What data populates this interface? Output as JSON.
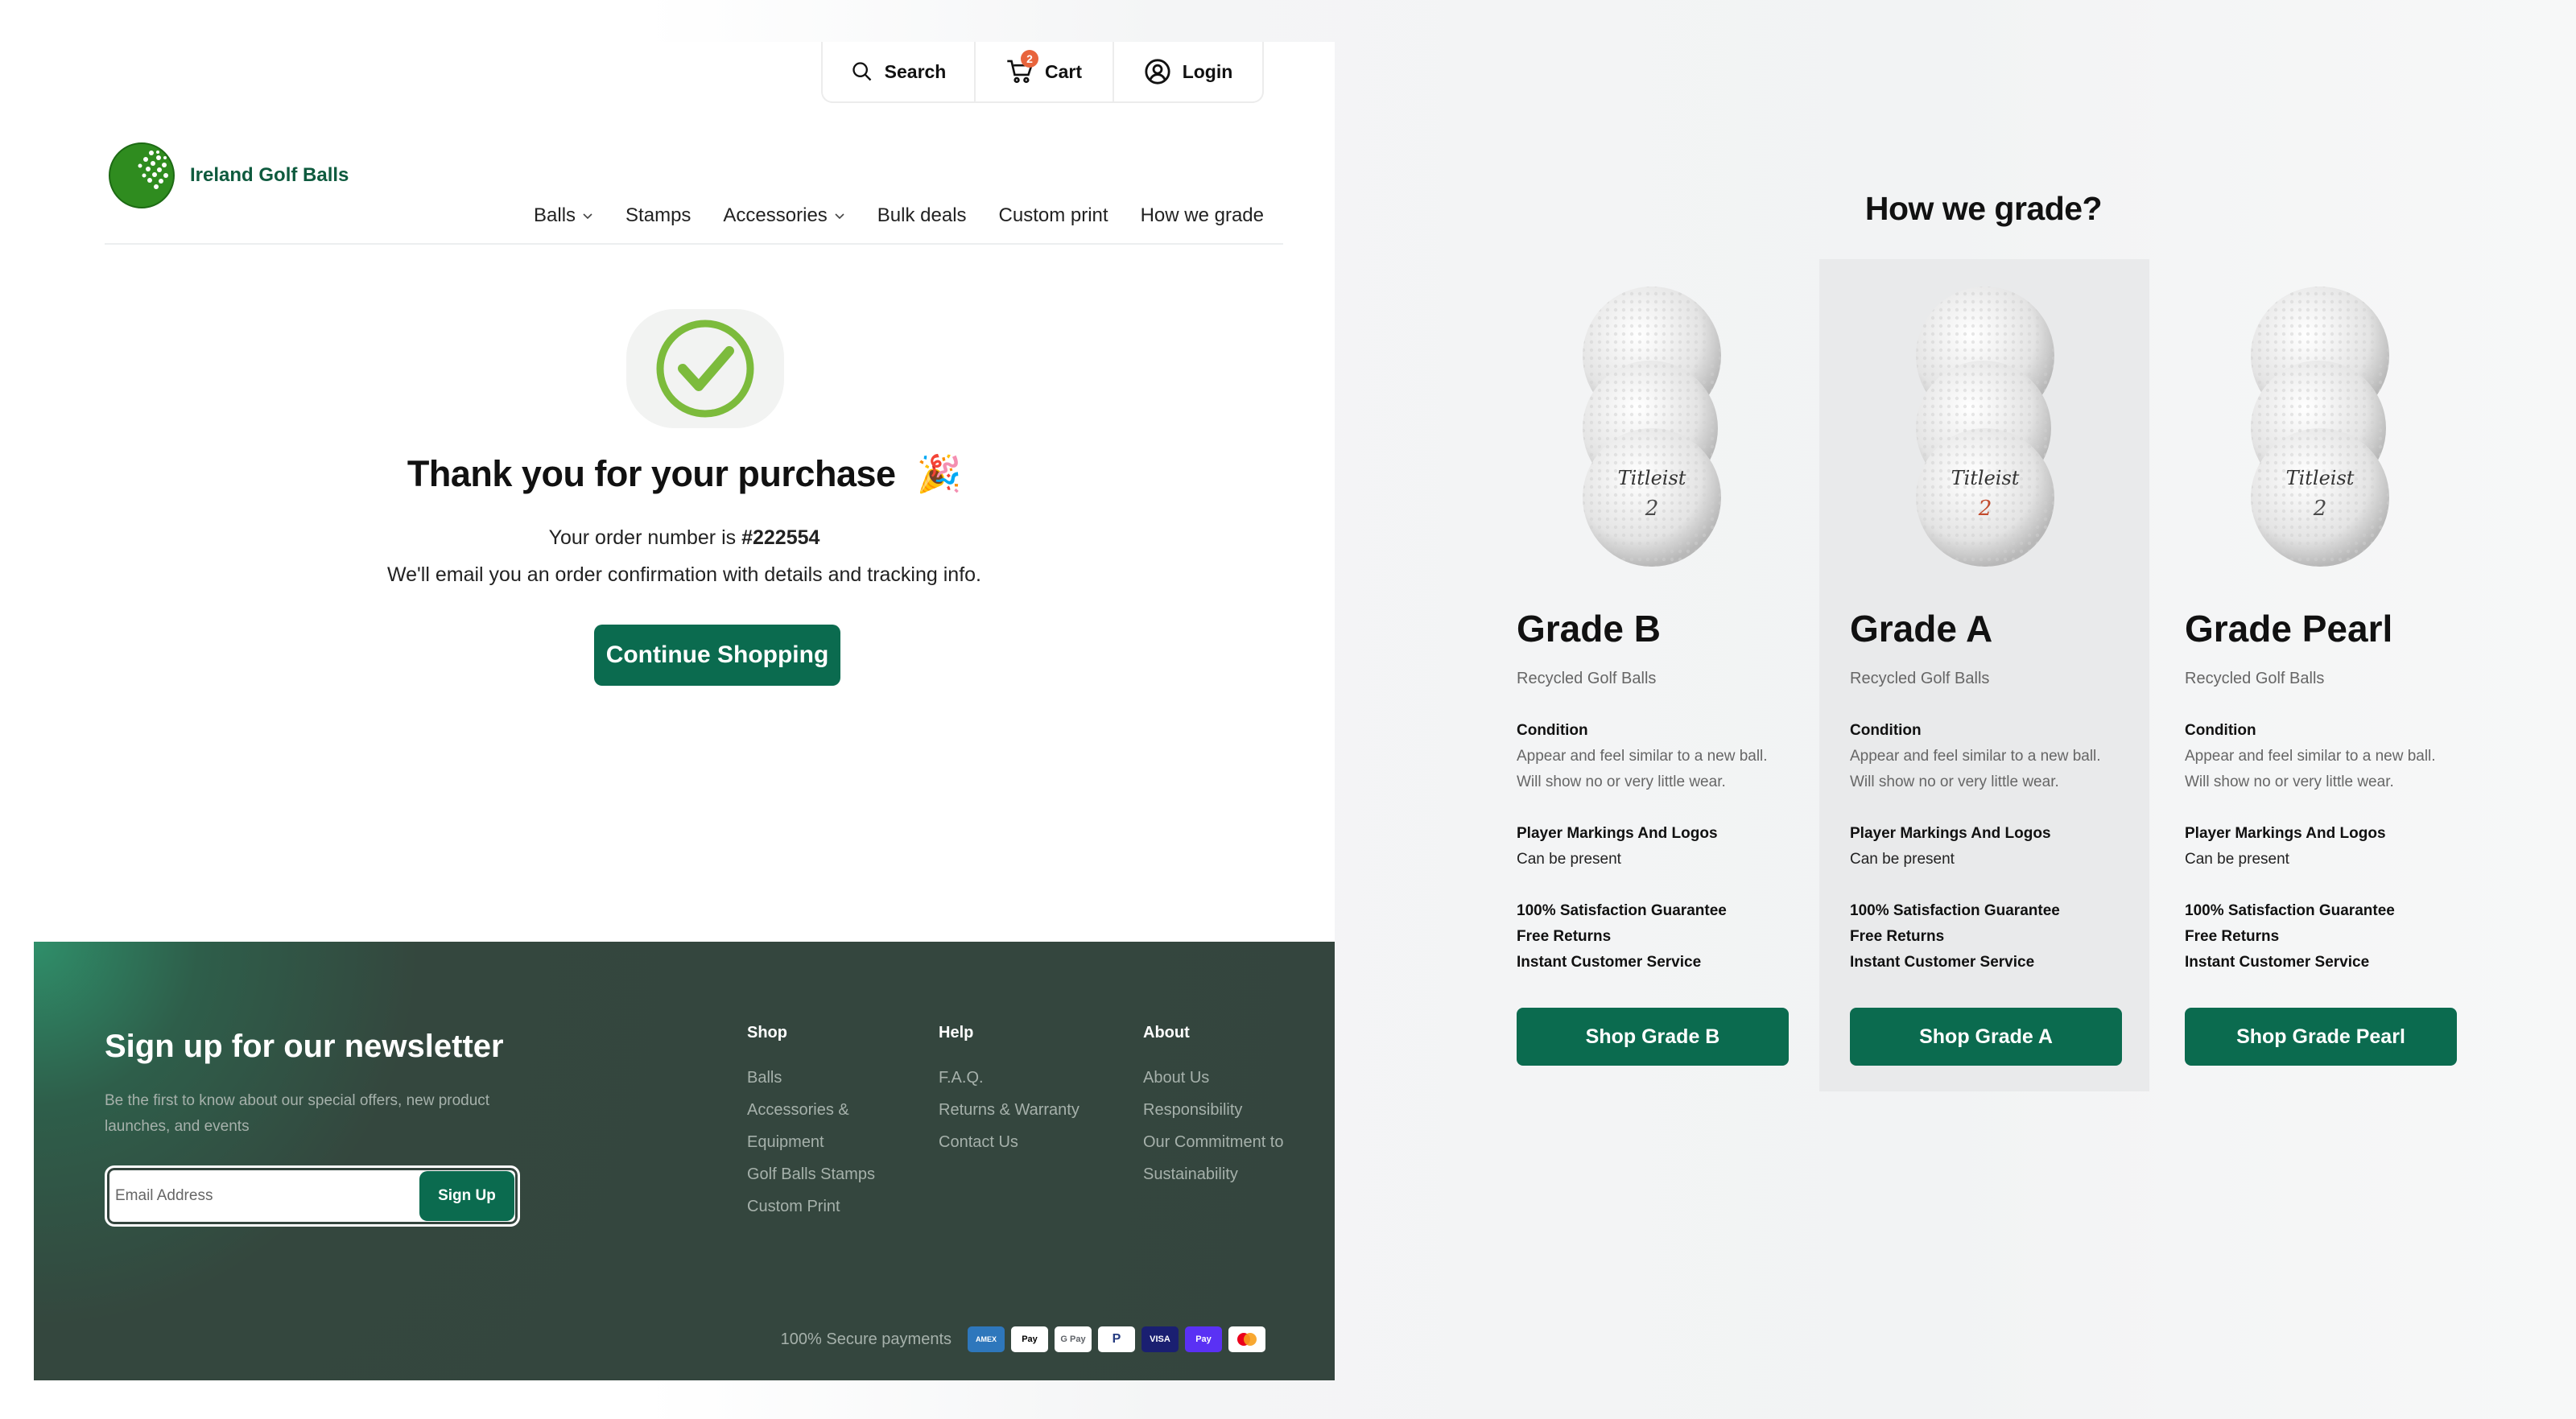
{
  "util_bar": {
    "search": "Search",
    "cart": "Cart",
    "cart_count": "2",
    "login": "Login"
  },
  "brand": {
    "name": "Ireland Golf Balls"
  },
  "nav": [
    "Balls",
    "Stamps",
    "Accessories",
    "Bulk deals",
    "Custom print",
    "How we grade"
  ],
  "confirmation": {
    "title": "Thank you for your purchase",
    "emoji": "🎉",
    "order_prefix": "Your order number is ",
    "order_number": "#222554",
    "email_note": "We'll email you an order confirmation with details and tracking info.",
    "cta": "Continue Shopping"
  },
  "footer": {
    "newsletter_title": "Sign up for our newsletter",
    "newsletter_desc": "Be the first to know about our special offers, new product launches, and events",
    "email_placeholder": "Email Address",
    "signup": "Sign Up",
    "columns": [
      {
        "title": "Shop",
        "links": [
          "Balls",
          "Accessories &",
          "Equipment",
          "Golf Balls Stamps",
          "Custom Print"
        ]
      },
      {
        "title": "Help",
        "links": [
          "F.A.Q.",
          "Returns & Warranty",
          "Contact Us"
        ]
      },
      {
        "title": "About",
        "links": [
          "About Us",
          "Responsibility",
          "Our Commitment to",
          "Sustainability"
        ]
      }
    ],
    "secure": "100% Secure payments",
    "payment_icons": [
      "amex-icon",
      "apple-pay-icon",
      "google-pay-icon",
      "paypal-icon",
      "visa-icon",
      "shop-pay-icon",
      "mastercard-icon"
    ]
  },
  "grading": {
    "title": "How we grade?",
    "grades": [
      {
        "name": "Grade B",
        "subtitle": "Recycled Golf Balls",
        "condition_label": "Condition",
        "condition_line1": "Appear and feel similar to a new ball.",
        "condition_line2": "Will show no or very little wear.",
        "markings_label": "Player Markings And Logos",
        "markings_value": "Can be present",
        "guarantee": "100% Satisfaction Guarantee",
        "returns": "Free Returns",
        "service": "Instant Customer Service",
        "cta": "Shop Grade B"
      },
      {
        "name": "Grade A",
        "subtitle": "Recycled Golf Balls",
        "condition_label": "Condition",
        "condition_line1": "Appear and feel similar to a new ball.",
        "condition_line2": "Will show no or very little wear.",
        "markings_label": "Player Markings And Logos",
        "markings_value": "Can be present",
        "guarantee": "100% Satisfaction Guarantee",
        "returns": "Free Returns",
        "service": "Instant Customer Service",
        "cta": "Shop Grade A"
      },
      {
        "name": "Grade Pearl",
        "subtitle": "Recycled Golf Balls",
        "condition_label": "Condition",
        "condition_line1": "Appear and feel similar to a new ball.",
        "condition_line2": "Will show no or very little wear.",
        "markings_label": "Player Markings And Logos",
        "markings_value": "Can be present",
        "guarantee": "100% Satisfaction Guarantee",
        "returns": "Free Returns",
        "service": "Instant Customer Service",
        "cta": "Shop Grade Pearl"
      }
    ],
    "ball_brand": "Titleist",
    "ball_number": "2"
  },
  "colors": {
    "brand_green": "#0b6b4f",
    "footer_bg": "#34453e",
    "check_green": "#7cbb3c",
    "badge": "#e8643c"
  }
}
